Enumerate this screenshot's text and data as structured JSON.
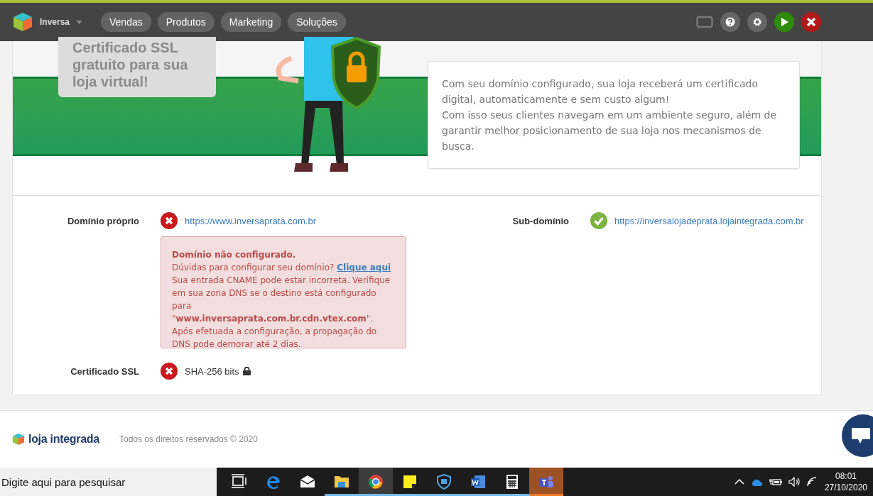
{
  "topbar": {
    "store": "Inversa",
    "nav": [
      {
        "label": "Vendas",
        "selected": false
      },
      {
        "label": "Produtos",
        "selected": false
      },
      {
        "label": "Marketing",
        "selected": false
      },
      {
        "label": "Soluções",
        "selected": false
      }
    ]
  },
  "banner": {
    "bubble_lines": [
      "Certificado SSL",
      "gratuito para sua",
      "loja virtual!"
    ],
    "info": [
      "Com seu domínio configurado, sua loja receberá um certificado digital, automaticamente e sem custo algum!",
      "Com isso seus clientes navegam em um ambiente seguro, além de garantir melhor posicionamento de sua loja nos mecanismos de busca."
    ]
  },
  "domains": [
    {
      "label": "Domínio próprio",
      "ok": false,
      "url": "https://www.inversaprata.com.br"
    },
    {
      "label": "Sub-domínio",
      "ok": true,
      "url": "https://inversalojadeprata.lojaintegrada.com.br"
    }
  ],
  "alert": {
    "title": "Domínio não configurado.",
    "question": "Dúvidas para configurar seu domínio?",
    "link": "Clique aqui",
    "body": "Sua entrada CNAME pode estar incorreta. Verifique em sua zona DNS se o destino está configurado para \"**www.inversaprata.com.br.cdn.vtex.com**\". Após efetuada a configuração, a propagação do DNS pode demorar até 2 dias."
  },
  "ssl": {
    "label": "Certificado SSL",
    "ok": false,
    "value": "SHA-256 bits"
  },
  "footer": {
    "brand": "loja integrada",
    "copyright": "Todos os direitos reservados © 2020"
  },
  "taskbar": {
    "search_placeholder": "Digite aqui para pesquisar",
    "apps": [
      {
        "kind": "taskview",
        "running": false,
        "selected": false
      },
      {
        "kind": "edge",
        "running": false,
        "selected": false
      },
      {
        "kind": "mail",
        "running": false,
        "selected": false
      },
      {
        "kind": "files",
        "running": true,
        "selected": false
      },
      {
        "kind": "chrome",
        "running": true,
        "selected": true
      },
      {
        "kind": "sticky",
        "running": true,
        "selected": false
      },
      {
        "kind": "defender",
        "running": true,
        "selected": false
      },
      {
        "kind": "word",
        "running": true,
        "selected": false
      },
      {
        "kind": "calculator",
        "running": true,
        "selected": false
      },
      {
        "kind": "teams",
        "running": true,
        "selected": false,
        "alert": true
      }
    ],
    "time": "08:01",
    "date": "27/10/2020"
  }
}
